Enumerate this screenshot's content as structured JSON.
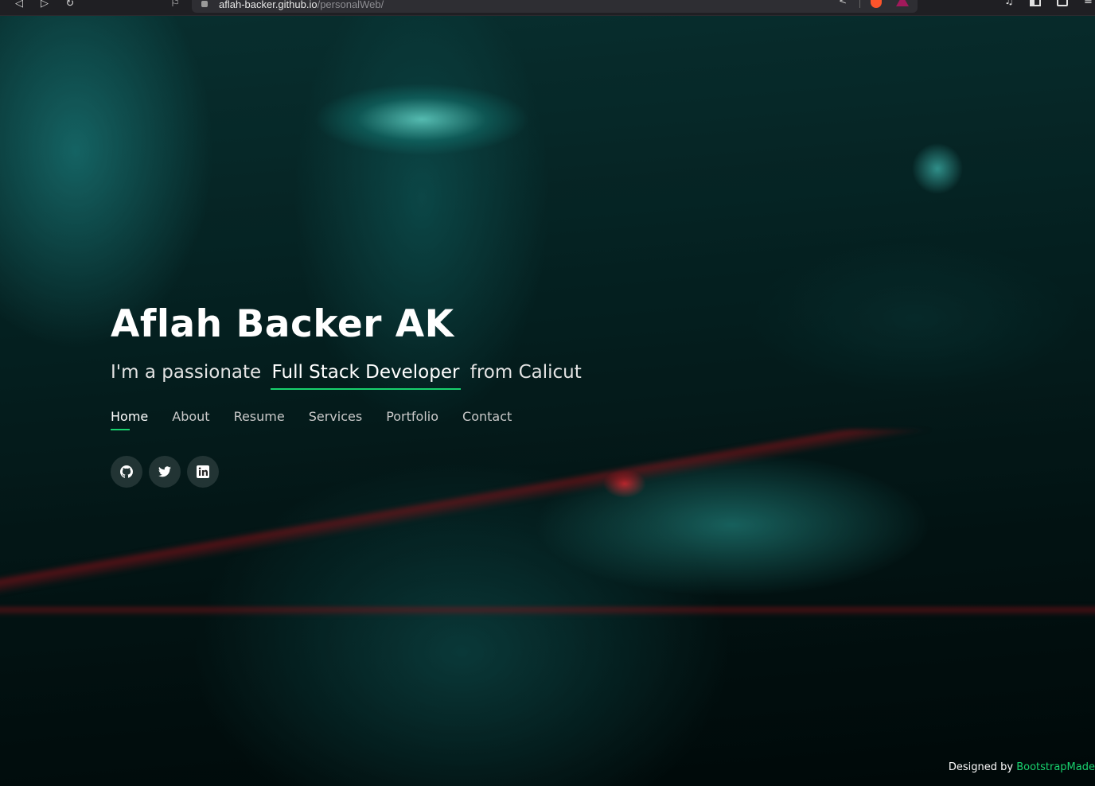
{
  "browser": {
    "url_host": "aflah-backer.github.io",
    "url_path": "/personalWeb/",
    "back_glyph": "◁",
    "forward_glyph": "▷",
    "reload_glyph": "↻",
    "bookmark_glyph": "⚐",
    "share_glyph": "<",
    "ext1_glyph": "♫",
    "menu_glyph": "≡"
  },
  "hero": {
    "name": "Aflah Backer AK",
    "tagline_prefix": "I'm a passionate",
    "tagline_role": "Full Stack Developer",
    "tagline_suffix": "from Calicut",
    "nav": [
      {
        "label": "Home",
        "active": true
      },
      {
        "label": "About",
        "active": false
      },
      {
        "label": "Resume",
        "active": false
      },
      {
        "label": "Services",
        "active": false
      },
      {
        "label": "Portfolio",
        "active": false
      },
      {
        "label": "Contact",
        "active": false
      }
    ],
    "social": [
      {
        "icon": "github-icon"
      },
      {
        "icon": "twitter-icon"
      },
      {
        "icon": "linkedin-icon"
      }
    ]
  },
  "credits": {
    "prefix": "Designed by",
    "link": "BootstrapMade"
  },
  "colors": {
    "accent": "#18d26e",
    "text": "#ffffff"
  }
}
